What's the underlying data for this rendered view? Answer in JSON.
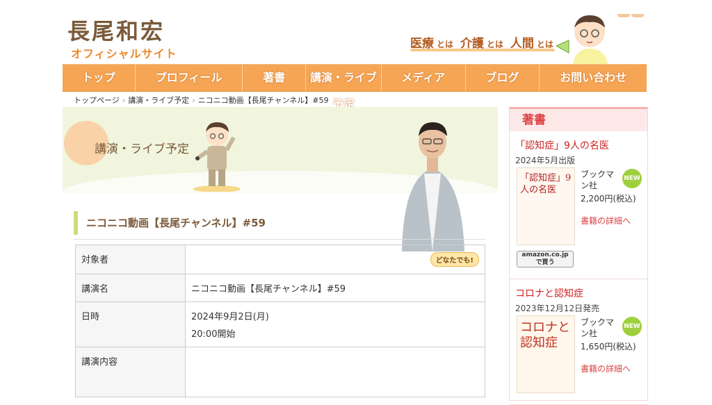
{
  "header": {
    "logo_main": "長尾和宏",
    "logo_sub": "オフィシャルサイト",
    "tagline": [
      {
        "big": "医療",
        "small": "とは"
      },
      {
        "big": "介護",
        "small": "とは"
      },
      {
        "big": "人間",
        "small": "とは"
      }
    ]
  },
  "nav": {
    "items": [
      "トップ",
      "プロフィール",
      "著書",
      "講演・ライブ予定",
      "メディア",
      "ブログ",
      "お問い合わせ"
    ]
  },
  "breadcrumb": [
    "トップページ",
    "講演・ライブ予定",
    "ニコニコ動画【長尾チャンネル】#59"
  ],
  "hero": {
    "title": "講演・ライブ予定"
  },
  "section": {
    "title": "ニコニコ動画【長尾チャンネル】#59"
  },
  "table": {
    "rows": [
      {
        "label": "対象者",
        "value": "",
        "badge": "どなたでも!"
      },
      {
        "label": "講演名",
        "value": "ニコニコ動画【長尾チャンネル】#59"
      },
      {
        "label": "日時",
        "value": "2024年9月2日(月)",
        "value2": "20:00開始"
      },
      {
        "label": "講演内容",
        "value": ""
      }
    ]
  },
  "sidebar": {
    "heading": "著書",
    "books": [
      {
        "title": "「認知症」9人の名医",
        "date": "2024年5月出版",
        "publisher": "ブックマン社",
        "price": "2,200円(税込)",
        "new": "NEW",
        "link": "書籍の詳細へ",
        "cover_text": "「認知症」9人の名医",
        "amazon_top": "amazon.co.jp",
        "amazon_bottom": "で買う"
      },
      {
        "title": "コロナと認知症",
        "date": "2023年12月12日発売",
        "publisher": "ブックマン社",
        "price": "1,650円(税込)",
        "new": "NEW",
        "link": "書籍の詳細へ",
        "cover_text": "コロナと認知症"
      }
    ]
  },
  "colors": {
    "nav_bg": "#f5a554",
    "accent_green": "#c9e07a",
    "sidebar_red": "#dd4444",
    "logo_brown": "#7a5a3a"
  }
}
